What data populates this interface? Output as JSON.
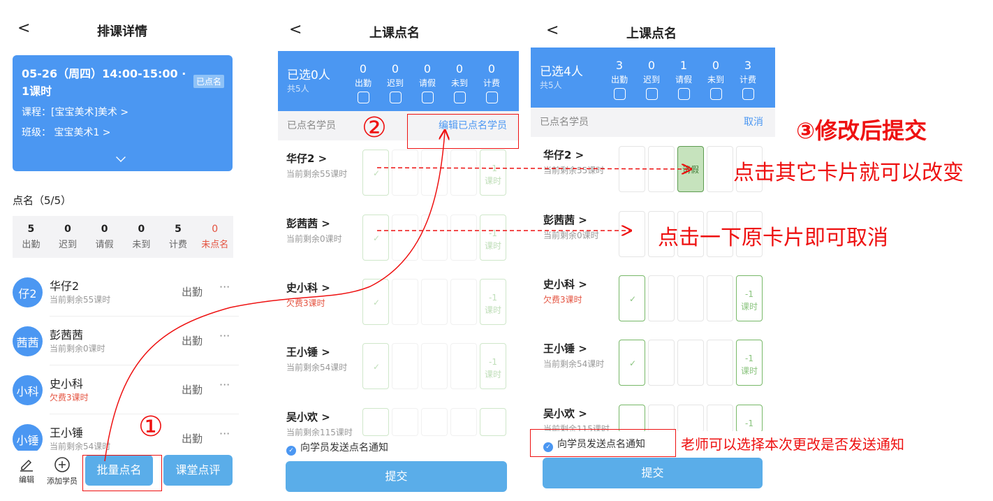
{
  "screen1": {
    "title": "排课详情",
    "back": "<",
    "card": {
      "when": "05-26（周四）14:00-15:00 · 1课时",
      "badge": "已点名",
      "course": "课程：[宝宝美术]美术 >",
      "class": "班级：  宝宝美术1 >"
    },
    "rollcall_title": "点名（5/5）",
    "stats": [
      {
        "num": "5",
        "label": "出勤"
      },
      {
        "num": "0",
        "label": "迟到"
      },
      {
        "num": "0",
        "label": "请假"
      },
      {
        "num": "0",
        "label": "未到"
      },
      {
        "num": "5",
        "label": "计费"
      },
      {
        "num": "0",
        "label": "未点名"
      }
    ],
    "students": [
      {
        "avatar": "仔2",
        "name": "华仔2",
        "sub": "当前剩余55课时",
        "status": "出勤",
        "more": "···"
      },
      {
        "avatar": "茜茜",
        "name": "彭茜茜",
        "sub": "当前剩余0课时",
        "status": "出勤",
        "more": "···"
      },
      {
        "avatar": "小科",
        "name": "史小科",
        "sub": "欠费3课时",
        "status": "出勤",
        "more": "···"
      },
      {
        "avatar": "小锤",
        "name": "王小锤",
        "sub": "当前剩余54课时",
        "status": "出勤",
        "more": "···"
      }
    ],
    "toolbar": {
      "edit": "编辑",
      "add": "添加学员",
      "batch": "批量点名",
      "review": "课堂点评"
    }
  },
  "screen2": {
    "title": "上课点名",
    "back": "<",
    "selected": "已选0人",
    "total": "共5人",
    "cols": [
      {
        "num": "0",
        "label": "出勤"
      },
      {
        "num": "0",
        "label": "迟到"
      },
      {
        "num": "0",
        "label": "请假"
      },
      {
        "num": "0",
        "label": "未到"
      },
      {
        "num": "0",
        "label": "计费"
      }
    ],
    "sub_left": "已点名学员",
    "sub_right": "编辑已点名学员",
    "students": [
      {
        "name": "华仔2 >",
        "sub": "当前剩余55课时"
      },
      {
        "name": "彭茜茜 >",
        "sub": "当前剩余0课时"
      },
      {
        "name": "史小科 >",
        "sub": "欠费3课时"
      },
      {
        "name": "王小锤 >",
        "sub": "当前剩余54课时"
      },
      {
        "name": "吴小欢 >",
        "sub": "当前剩余115课时"
      }
    ],
    "fee_card": "-1\n课时",
    "check": "✓",
    "notify": "向学员发送点名通知",
    "submit": "提交"
  },
  "screen3": {
    "title": "上课点名",
    "back": "<",
    "selected": "已选4人",
    "total": "共5人",
    "cols": [
      {
        "num": "3",
        "label": "出勤"
      },
      {
        "num": "0",
        "label": "迟到"
      },
      {
        "num": "1",
        "label": "请假"
      },
      {
        "num": "0",
        "label": "未到"
      },
      {
        "num": "3",
        "label": "计费"
      }
    ],
    "sub_left": "已点名学员",
    "sub_right": "取消",
    "students": [
      {
        "name": "华仔2 >",
        "sub": "当前剩余55课时"
      },
      {
        "name": "彭茜茜 >",
        "sub": "当前剩余0课时"
      },
      {
        "name": "史小科 >",
        "sub": "欠费3课时"
      },
      {
        "name": "王小锤 >",
        "sub": "当前剩余54课时"
      },
      {
        "name": "吴小欢 >",
        "sub": "当前剩余115课时"
      }
    ],
    "leave_card": "请假",
    "fee_card": "-1\n课时",
    "check": "✓",
    "notify": "向学员发送点名通知",
    "submit": "提交"
  },
  "annotations": {
    "step1": "①",
    "step2": "②",
    "step3": "③修改后提交",
    "tap_other": "点击其它卡片就可以改变",
    "tap_again": "点击一下原卡片即可取消",
    "teacher_note": "老师可以选择本次更改是否发送通知"
  },
  "colors": {
    "brand_blue": "#4b97f2",
    "button_blue": "#5aade9",
    "annotation_red": "#ee1111",
    "check_green": "#8bc47f",
    "leave_green": "#c6e3bd"
  }
}
